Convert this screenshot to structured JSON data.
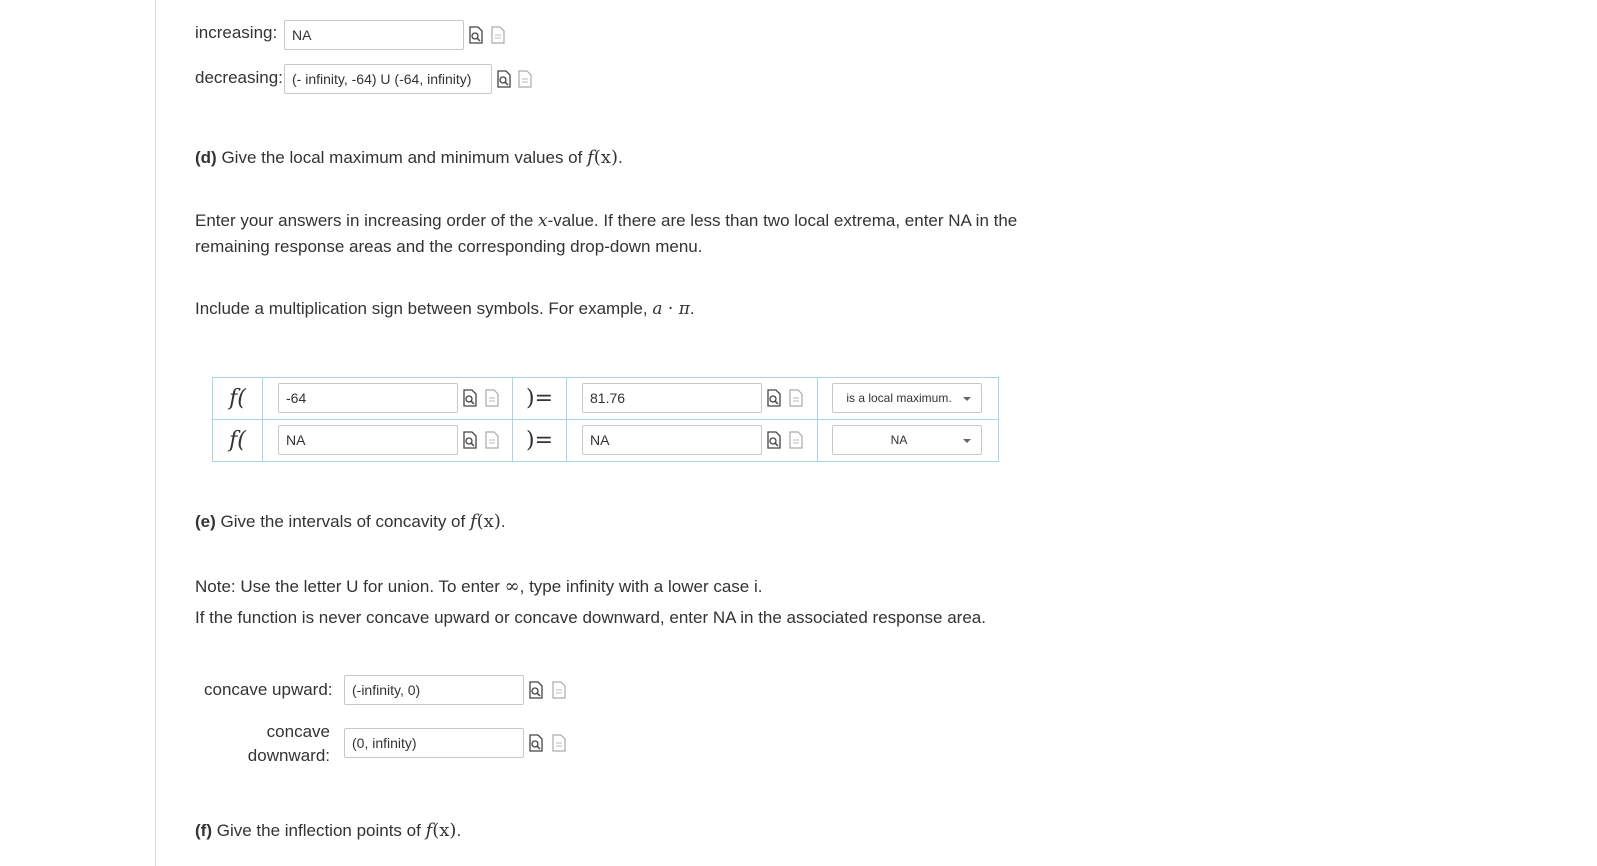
{
  "monotonic": {
    "increasing_label": "increasing:",
    "increasing_value": "NA",
    "decreasing_label": "decreasing:",
    "decreasing_value": "(- infinity, -64) U (-64, infinity)"
  },
  "part_d": {
    "tag": "(d)",
    "question": "Give the local maximum and minimum values of",
    "func": "f",
    "arg": "(x)",
    "period": ".",
    "instr_1a": "Enter your answers in increasing order of the",
    "instr_1x": "x",
    "instr_1b": "-value. If there are less than two local extrema, enter NA in the",
    "instr_2": "remaining response areas and the corresponding drop-down menu.",
    "mult_text": "Include a multiplication sign between symbols. For example,",
    "mult_example": "a · π",
    "mult_period": "."
  },
  "extrema": [
    {
      "f_label": "f(",
      "x_value": "-64",
      "eq_label": ")=",
      "y_value": "81.76",
      "type": "is a local maximum."
    },
    {
      "f_label": "f(",
      "x_value": "NA",
      "eq_label": ")=",
      "y_value": "NA",
      "type": "NA"
    }
  ],
  "part_e": {
    "tag": "(e)",
    "question": "Give the intervals of concavity of",
    "func": "f",
    "arg": "(x)",
    "period": ".",
    "note_1a": "Note: Use the letter U for union. To enter",
    "note_1inf": "∞",
    "note_1b": ", type infinity with a lower case i.",
    "note_2": "If the function is never concave upward or concave downward, enter NA in the associated response area.",
    "up_label": "concave upward:",
    "up_value": "(-infinity, 0)",
    "down_label_1": "concave",
    "down_label_2": "downward:",
    "down_value": "(0, infinity)"
  },
  "part_f": {
    "tag": "(f)",
    "question": "Give the inflection points of",
    "func": "f",
    "arg": "(x)",
    "period": "."
  }
}
